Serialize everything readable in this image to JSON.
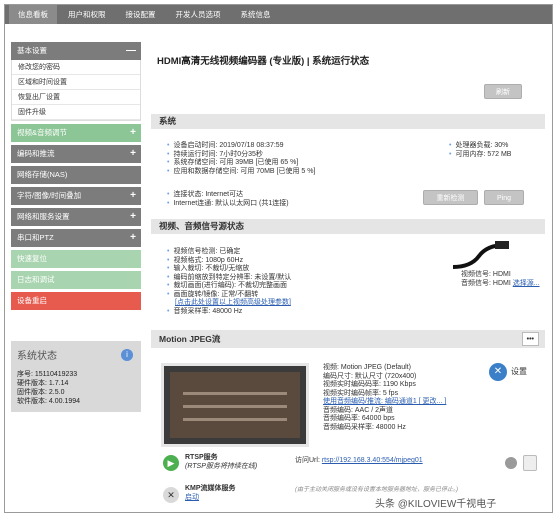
{
  "topnav": {
    "tabs": [
      "信息看板",
      "用户和权限",
      "接设配置",
      "开发人员选项",
      "系统信息"
    ],
    "active": 0
  },
  "sidebar": {
    "groups": [
      {
        "label": "基本设置",
        "sign": "—",
        "color": "gray",
        "items": [
          "修改您的密码",
          "区域和时间设置",
          "恢复出厂设置",
          "固件升级"
        ]
      },
      {
        "label": "视频&音频调节",
        "sign": "+",
        "color": "green",
        "items": []
      },
      {
        "label": "编码和推流",
        "sign": "+",
        "color": "dark",
        "items": []
      },
      {
        "label": "网络存储(NAS)",
        "sign": "",
        "color": "dark",
        "items": []
      },
      {
        "label": "字符/图像/时间叠加",
        "sign": "+",
        "color": "dark",
        "items": []
      },
      {
        "label": "网络和服务设置",
        "sign": "+",
        "color": "dark",
        "items": []
      },
      {
        "label": "串口和PTZ",
        "sign": "+",
        "color": "dark",
        "items": []
      },
      {
        "label": "快速复位",
        "sign": "",
        "color": "lightgreen",
        "items": []
      },
      {
        "label": "日志和调试",
        "sign": "",
        "color": "lightgreen",
        "items": []
      },
      {
        "label": "设备重启",
        "sign": "",
        "color": "red",
        "items": []
      }
    ]
  },
  "status": {
    "title": "系统状态",
    "serial": "序号: 15110419233",
    "hw": "硬件版本: 1.7.14",
    "fw": "固件版本: 2.5.0",
    "sw": "软件版本: 4.00.1994"
  },
  "main": {
    "title": "HDMI高清无线视频编码器 (专业版) | 系统运行状态",
    "refresh_label": "刷新",
    "system": {
      "heading": "系统",
      "rows": [
        "设备启动时间: 2019/07/18 08:37:59",
        "持续运行时间: 7小时0分35秒",
        "系统存储空间: 可用 39MB [已使用 65 %]",
        "应用和数据存储空间: 可用 70MB [已使用 5 %]"
      ],
      "cpu": "处理器负载: 30%",
      "mem_label": "可用内存: ",
      "mem_value": "572 MB",
      "net_rows": [
        "连接状态: Internet可达",
        "Internet连通: 默认以太网口 (共1连接)"
      ],
      "recheck_label": "重新检测",
      "ping_label": "Ping"
    },
    "av": {
      "heading": "视频、音频信号源状态",
      "rows": [
        "视频信号检测: 已确定",
        "视频格式: 1080p 60Hz",
        "输入裁切: 不裁切/无缩放",
        "编码前缩放到特定分辨率: 未设置/默认",
        "裁切画面(进行编码): 不裁切完整画面",
        "画面旋转/镜像: 正常/不翻转",
        "[点击此处设置以上视频高级处理参数]",
        "音频采样率: 48000 Hz"
      ],
      "video_signal": "视频信号: HDMI",
      "audio_signal_label": "音频信号: HDMI ",
      "audio_signal_link": "选择源..."
    },
    "mjpeg": {
      "heading": "Motion JPEG流",
      "more": "•••",
      "rows": [
        "视频: Motion JPEG (Default)",
        "编码尺寸: 默认尺寸 (720x400)",
        "视频实时编码码率: 1190 Kbps",
        "视频实时编码帧率: 5 fps",
        "使用音频编码/推流: 编码通道1 [ 更改... ]",
        "音频编码: AAC / 2声道",
        "音频编码率: 64000 bps",
        "音频编码采样率: 48000 Hz"
      ],
      "settings_label": "设置"
    },
    "services": [
      {
        "name": "RTSP服务",
        "sub": "(RTSP服务将持续在线)",
        "url_label": "访问Url: ",
        "url": "rtsp://192.168.3.40:554/mjpeg01"
      },
      {
        "name": "KMP流媒体服务",
        "sub": "启动",
        "note": "(由于主动关闭服务或没有设置本地服务器地址，服务已停止。)"
      }
    ]
  },
  "watermark": "头条 @KILOVIEW千视电子",
  "colors": {
    "nav": "#6f6f6f",
    "accent_green": "#8cc596",
    "danger": "#e75a4e",
    "link": "#2a5db0"
  }
}
